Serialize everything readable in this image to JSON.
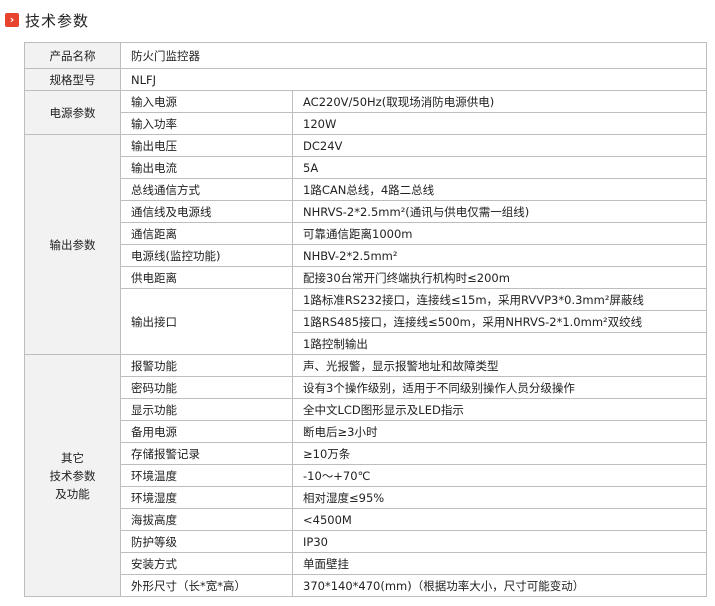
{
  "header": {
    "icon": "›",
    "title": "技术参数"
  },
  "basic": [
    {
      "label": "产品名称",
      "value": "防火门监控器"
    },
    {
      "label": "规格型号",
      "value": "NLFJ"
    }
  ],
  "groups": [
    {
      "category": "电源参数",
      "rows": [
        {
          "name": "输入电源",
          "value": "AC220V/50Hz(取现场消防电源供电)"
        },
        {
          "name": "输入功率",
          "value": "120W"
        }
      ]
    },
    {
      "category": "输出参数",
      "rows": [
        {
          "name": "输出电压",
          "value": "DC24V"
        },
        {
          "name": "输出电流",
          "value": "5A"
        },
        {
          "name": "总线通信方式",
          "value": "1路CAN总线，4路二总线"
        },
        {
          "name": "通信线及电源线",
          "value": "NHRVS-2*2.5mm²(通讯与供电仅需一组线)"
        },
        {
          "name": "通信距离",
          "value": "可靠通信距离1000m"
        },
        {
          "name": "电源线(监控功能)",
          "value": "NHBV-2*2.5mm²"
        },
        {
          "name": "供电距离",
          "value": "配接30台常开门终端执行机构时≤200m"
        }
      ],
      "output_interface": {
        "name": "输出接口",
        "values": [
          "1路标准RS232接口，连接线≤15m，采用RVVP3*0.3mm²屏蔽线",
          "1路RS485接口，连接线≤500m，采用NHRVS-2*1.0mm²双绞线",
          "1路控制输出"
        ]
      }
    },
    {
      "category": "其它\n技术参数\n及功能",
      "category_lines": [
        "其它",
        "技术参数",
        "及功能"
      ],
      "rows": [
        {
          "name": "报警功能",
          "value": "声、光报警，显示报警地址和故障类型"
        },
        {
          "name": "密码功能",
          "value": "设有3个操作级别，适用于不同级别操作人员分级操作"
        },
        {
          "name": "显示功能",
          "value": "全中文LCD图形显示及LED指示"
        },
        {
          "name": "备用电源",
          "value": "断电后≥3小时"
        },
        {
          "name": "存储报警记录",
          "value": "≥10万条"
        },
        {
          "name": "环境温度",
          "value": "-10～+70℃"
        },
        {
          "name": "环境湿度",
          "value": "相对湿度≤95%"
        },
        {
          "name": "海拔高度",
          "value": "<4500M"
        },
        {
          "name": "防护等级",
          "value": "IP30"
        },
        {
          "name": "安装方式",
          "value": "单面壁挂"
        },
        {
          "name": "外形尺寸（长*宽*高）",
          "value": "370*140*470(mm)（根据功率大小，尺寸可能变动）"
        }
      ]
    }
  ]
}
